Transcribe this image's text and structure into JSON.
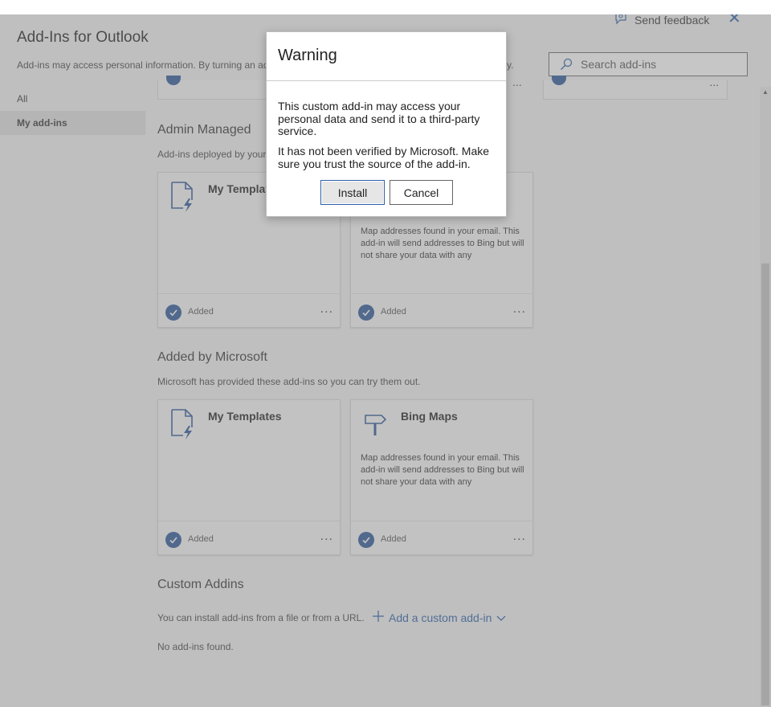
{
  "header": {
    "title": "Add-Ins for Outlook",
    "subtitle": "Add-ins may access personal information. By turning an ad",
    "subtitle_tail": "cy.",
    "feedback_label": "Send feedback",
    "search_placeholder": "Search add-ins"
  },
  "nav": {
    "items": [
      {
        "label": "All"
      },
      {
        "label": "My add-ins"
      }
    ]
  },
  "sections": {
    "admin": {
      "heading": "Admin Managed",
      "description": "Add-ins deployed by your"
    },
    "microsoft": {
      "heading": "Added by Microsoft",
      "description": "Microsoft has provided these add-ins so you can try them out."
    },
    "custom": {
      "heading": "Custom Addins",
      "description": "You can install add-ins from a file or from a URL.",
      "add_label": "Add a custom add-in",
      "empty": "No add-ins found."
    }
  },
  "cards": {
    "admin_templates": {
      "name": "My Templates",
      "status": "Added"
    },
    "admin_maps": {
      "description": "Map addresses found in your email. This add-in will send addresses to Bing but will not share your data with any",
      "status": "Added"
    },
    "ms_templates": {
      "name": "My Templates",
      "status": "Added"
    },
    "ms_maps": {
      "name": "Bing Maps",
      "description": "Map addresses found in your email. This add-in will send addresses to Bing but will not share your data with any",
      "status": "Added"
    },
    "more_label": "..."
  },
  "dialog": {
    "title": "Warning",
    "paragraph1": "This custom add-in may access your personal data and send it to a third-party service.",
    "paragraph2": "It has not been verified by Microsoft. Make sure you trust the source of the add-in.",
    "install_label": "Install",
    "cancel_label": "Cancel"
  },
  "colors": {
    "accent": "#2b5fa8",
    "check": "#2b5797"
  }
}
